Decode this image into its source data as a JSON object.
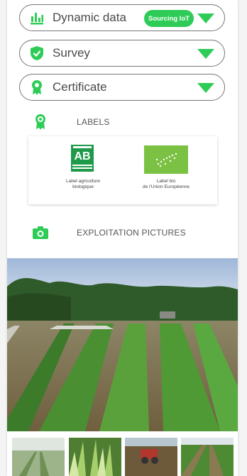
{
  "accordions": [
    {
      "label": "Dynamic data",
      "badge": "Sourcing IoT",
      "icon": "bar-chart-icon"
    },
    {
      "label": "Survey",
      "icon": "shield-check-icon"
    },
    {
      "label": "Certificate",
      "icon": "award-ribbon-icon"
    }
  ],
  "sections": {
    "labels": {
      "title": "LABELS",
      "icon": "award-ribbon-icon"
    },
    "pictures": {
      "title": "EXPLOITATION PICTURES",
      "icon": "camera-icon"
    }
  },
  "labels": [
    {
      "caption_line1": "Label agriculture",
      "caption_line2": "biologique",
      "logo_text": "AB",
      "logo_small": "AGRICULTURE BIOLOGIQUE"
    },
    {
      "caption_line1": "Label bio",
      "caption_line2": "de l'Union Européenne"
    }
  ],
  "colors": {
    "accent": "#2ecc57",
    "ab_green": "#1f9a4a",
    "eu_green": "#7bc143"
  }
}
